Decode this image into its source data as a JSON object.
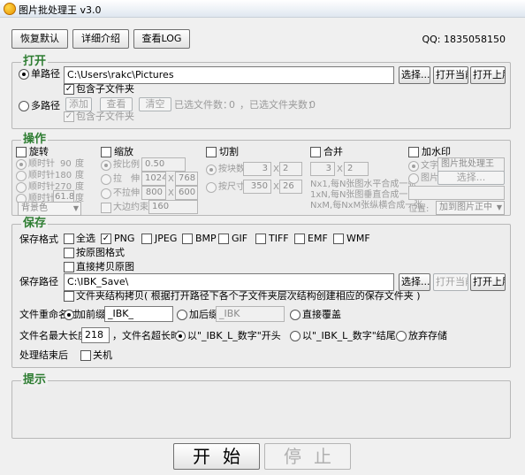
{
  "window": {
    "title": "图片批处理王 v3.0"
  },
  "toolbar": {
    "restore_default": "恢复默认",
    "details": "详细介绍",
    "view_log": "查看LOG",
    "qq": "QQ: 1835058150"
  },
  "open": {
    "legend": "打开",
    "single_path_label": "单路径",
    "single_path_value": "C:\\Users\\rakc\\Pictures",
    "include_subfolders": "包含子文件夹",
    "select_btn": "选择...",
    "open_current_btn": "打开当前",
    "open_parent_btn": "打开上层",
    "multi_path_label": "多路径",
    "add_btn": "添加",
    "view_btn": "查看",
    "clear_btn": "清空",
    "selected_files": "已选文件数：",
    "selected_files_count": "0",
    "selected_folders": "，已选文件夹数：",
    "selected_folders_count": "0",
    "include_subfolders_multi": "包含子文件夹"
  },
  "ops": {
    "legend": "操作",
    "rotate": {
      "label": "旋转",
      "cw90_prefix": "顺时针",
      "cw90_value": "90",
      "cw90_unit": "度",
      "cw180_prefix": "顺时针",
      "cw180_value": "180",
      "cw180_unit": "度",
      "cw270_prefix": "顺时针",
      "cw270_value": "270",
      "cw270_unit": "度",
      "custom_prefix": "顺时针",
      "custom_value": "61.8",
      "custom_unit": "度",
      "bg_color": "背景色"
    },
    "scale": {
      "label": "缩放",
      "ratio_label": "按比例",
      "ratio_value": "0.50",
      "stretch_label": "拉　伸",
      "stretch_w": "1024",
      "stretch_h": "768",
      "nostretch_label": "不拉伸",
      "nostretch_w": "800",
      "nostretch_h": "600",
      "maxside_label": "大边约束",
      "maxside_value": "160",
      "x": "X"
    },
    "cut": {
      "label": "切割",
      "by_count_label": "按块数",
      "by_count_a": "3",
      "by_count_b": "2",
      "by_size_label": "按尺寸",
      "by_size_a": "350",
      "by_size_b": "26",
      "x": "X"
    },
    "merge": {
      "label": "合并",
      "a": "3",
      "b": "2",
      "x": "X",
      "desc1": "Nx1,每N张图水平合成一张",
      "desc2": "1xN,每N张图垂直合成一张",
      "desc3": "NxM,每NxM张纵横合成一张"
    },
    "watermark": {
      "label": "加水印",
      "text_label": "文字",
      "text_value": "图片批处理王",
      "image_label": "图片",
      "image_btn": "选择...",
      "position_label": "位置:",
      "position_value": "加到图片正中"
    }
  },
  "save": {
    "legend": "保存",
    "format_label": "保存格式",
    "all": "全选",
    "formats": [
      "PNG",
      "JPEG",
      "BMP",
      "GIF",
      "TIFF",
      "EMF",
      "WMF"
    ],
    "keep_original_format": "按原图格式",
    "copy_original": "直接拷贝原图",
    "path_label": "保存路径",
    "path_value": "C:\\IBK_Save\\",
    "select_btn": "选择...",
    "open_current_btn": "打开当前",
    "open_parent_btn": "打开上层",
    "keep_structure": "文件夹结构拷贝( 根据打开路径下各个子文件夹层次结构创建相应的保存文件夹 )",
    "rename_label": "文件重命名时",
    "prefix_label": "加前缀",
    "prefix_value": "_IBK_",
    "suffix_label": "加后缀",
    "suffix_value": "_IBK",
    "overwrite_label": "直接覆盖",
    "maxlen_label": "文件名最大长度",
    "maxlen_value": "218",
    "toolong_label": "，文件名超长时",
    "opt_start": "以\"_IBK_L_数字\"开头",
    "opt_end": "以\"_IBK_L_数字\"结尾",
    "opt_skip": "放弃存储",
    "after_label": "处理结束后",
    "shutdown": "关机"
  },
  "hint": {
    "legend": "提示"
  },
  "actions": {
    "start": "开始",
    "stop": "停止"
  }
}
